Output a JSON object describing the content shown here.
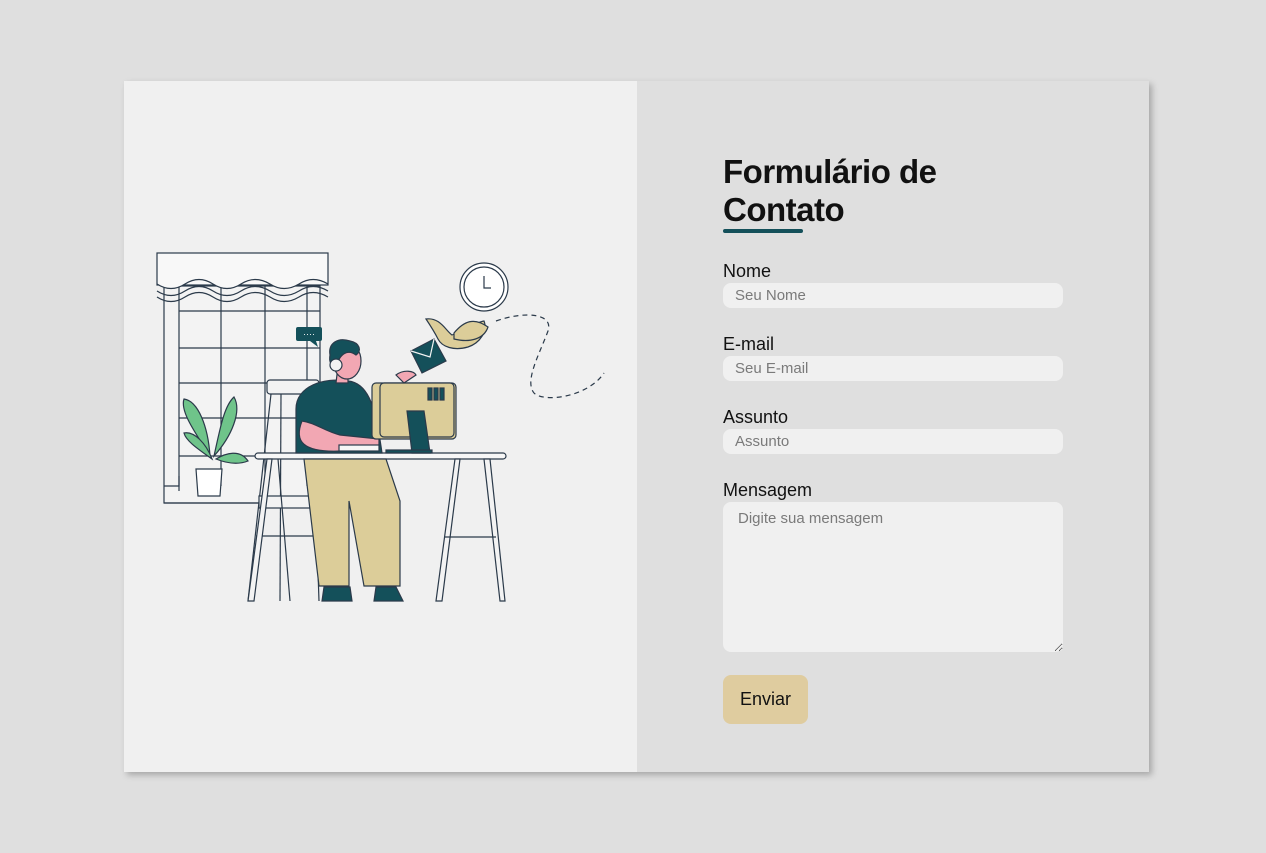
{
  "form": {
    "title": "Formulário de Contato",
    "fields": {
      "name": {
        "label": "Nome",
        "placeholder": "Seu Nome"
      },
      "email": {
        "label": "E-mail",
        "placeholder": "Seu E-mail"
      },
      "subject": {
        "label": "Assunto",
        "placeholder": "Assunto"
      },
      "message": {
        "label": "Mensagem",
        "placeholder": "Digite sua mensagem"
      }
    },
    "submit_label": "Enviar"
  },
  "illustration": {
    "icon": "person-working-at-computer-illustration",
    "speech_bubble_text": "····"
  },
  "colors": {
    "accent": "#14505a",
    "button": "#dfcc9f",
    "panel_left": "#f0f0f0",
    "panel_right": "#dfdfdf",
    "plant_green": "#6fc48a",
    "skin": "#f2a7b3",
    "sand": "#dccd99"
  }
}
